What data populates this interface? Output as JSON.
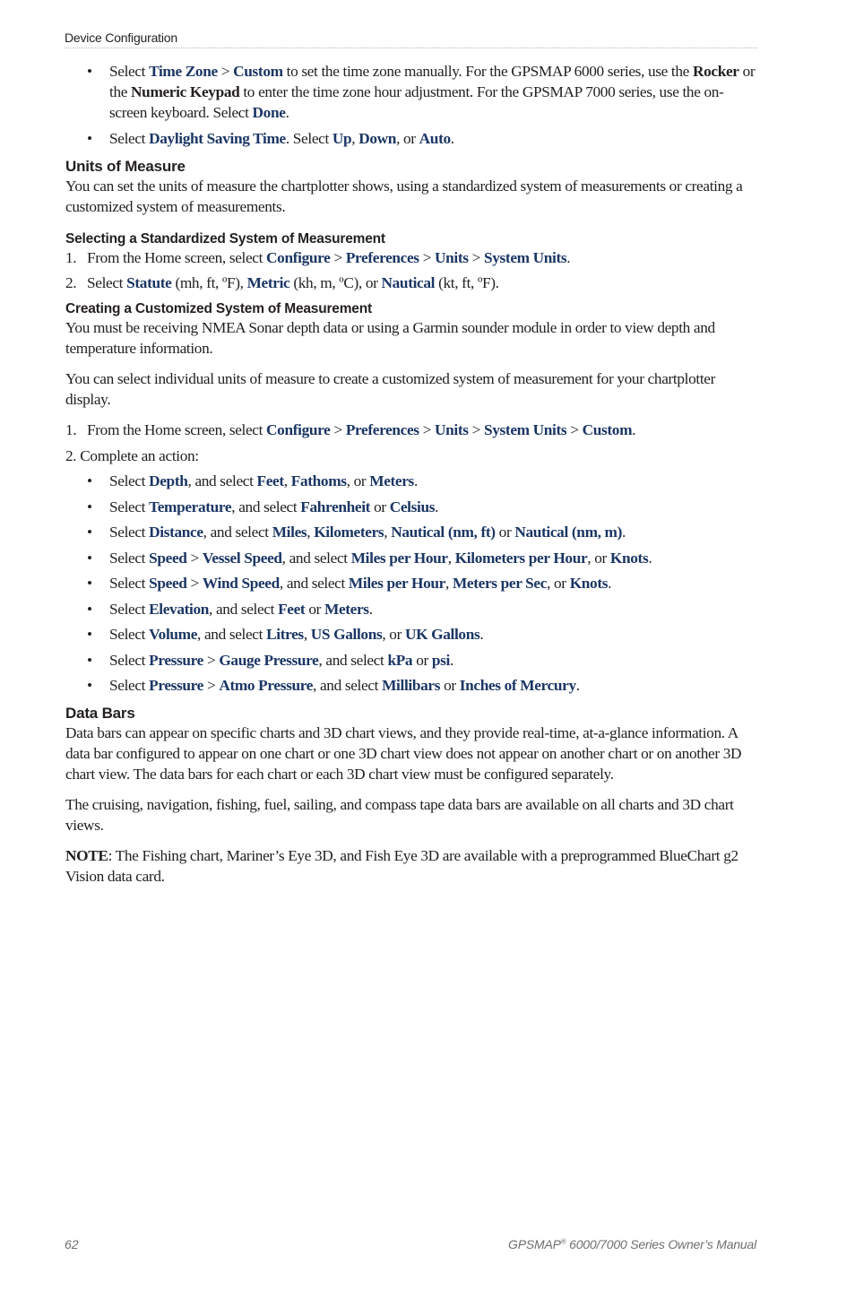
{
  "header": {
    "running_head": "Device Configuration"
  },
  "time_zone_bullets": [
    {
      "parts": [
        {
          "t": "Select "
        },
        {
          "b": "Time Zone"
        },
        {
          "t": " > "
        },
        {
          "b": "Custom"
        },
        {
          "t": " to set the time zone manually. For the GPSMAP 6000 series, use the "
        },
        {
          "k": "Rocker"
        },
        {
          "t": " or the "
        },
        {
          "k": "Numeric Keypad"
        },
        {
          "t": " to enter the time zone hour adjustment. For the GPSMAP 7000 series, use the on-screen keyboard. Select "
        },
        {
          "b": "Done"
        },
        {
          "t": "."
        }
      ]
    },
    {
      "parts": [
        {
          "t": "Select "
        },
        {
          "b": "Daylight Saving Time"
        },
        {
          "t": ". Select "
        },
        {
          "b": "Up"
        },
        {
          "t": ", "
        },
        {
          "b": "Down"
        },
        {
          "t": ", or "
        },
        {
          "b": "Auto"
        },
        {
          "t": "."
        }
      ]
    }
  ],
  "units": {
    "heading": "Units of Measure",
    "intro": "You can set the units of measure the chartplotter shows, using a standardized system of measurements or creating a customized system of measurements.",
    "standard": {
      "heading": "Selecting a Standardized System of Measurement",
      "steps": [
        {
          "num": "1.",
          "parts": [
            {
              "t": "From the Home screen, select "
            },
            {
              "b": "Configure"
            },
            {
              "t": " > "
            },
            {
              "b": "Preferences"
            },
            {
              "t": " > "
            },
            {
              "b": "Units"
            },
            {
              "t": " > "
            },
            {
              "b": "System Units"
            },
            {
              "t": "."
            }
          ]
        },
        {
          "num": "2.",
          "parts": [
            {
              "t": "Select "
            },
            {
              "b": "Statute"
            },
            {
              "t": " (mh, ft, ºF), "
            },
            {
              "b": "Metric"
            },
            {
              "t": " (kh, m, ºC), or "
            },
            {
              "b": "Nautical"
            },
            {
              "t": " (kt, ft, ºF)."
            }
          ]
        }
      ]
    },
    "custom": {
      "heading": "Creating a Customized System of Measurement",
      "para1": "You must be receiving NMEA Sonar depth data or using a Garmin sounder module in order to view depth and temperature information.",
      "para2": "You can select individual units of measure to create a customized system of measurement for your chartplotter display.",
      "step1": {
        "num": "1.",
        "parts": [
          {
            "t": "From the Home screen, select "
          },
          {
            "b": "Configure"
          },
          {
            "t": " > "
          },
          {
            "b": "Preferences"
          },
          {
            "t": " > "
          },
          {
            "b": "Units"
          },
          {
            "t": " > "
          },
          {
            "b": "System Units"
          },
          {
            "t": " > "
          },
          {
            "b": "Custom"
          },
          {
            "t": "."
          }
        ]
      },
      "step2": "2. Complete an action:",
      "bullets": [
        {
          "parts": [
            {
              "t": "Select "
            },
            {
              "b": "Depth"
            },
            {
              "t": ", and select "
            },
            {
              "b": "Feet"
            },
            {
              "t": ", "
            },
            {
              "b": "Fathoms"
            },
            {
              "t": ", or "
            },
            {
              "b": "Meters"
            },
            {
              "t": "."
            }
          ]
        },
        {
          "parts": [
            {
              "t": "Select "
            },
            {
              "b": "Temperature"
            },
            {
              "t": ", and select "
            },
            {
              "b": "Fahrenheit"
            },
            {
              "t": " or "
            },
            {
              "b": "Celsius"
            },
            {
              "t": "."
            }
          ]
        },
        {
          "parts": [
            {
              "t": "Select "
            },
            {
              "b": "Distance"
            },
            {
              "t": ", and select "
            },
            {
              "b": "Miles"
            },
            {
              "t": ", "
            },
            {
              "b": "Kilometers"
            },
            {
              "t": ", "
            },
            {
              "b": "Nautical (nm, ft)"
            },
            {
              "t": " or "
            },
            {
              "b": "Nautical (nm, m)"
            },
            {
              "t": "."
            }
          ]
        },
        {
          "parts": [
            {
              "t": "Select "
            },
            {
              "b": "Speed"
            },
            {
              "t": " > "
            },
            {
              "b": "Vessel Speed"
            },
            {
              "t": ", and select "
            },
            {
              "b": "Miles per Hour"
            },
            {
              "t": ", "
            },
            {
              "b": "Kilometers per Hour"
            },
            {
              "t": ", or "
            },
            {
              "b": "Knots"
            },
            {
              "t": "."
            }
          ]
        },
        {
          "parts": [
            {
              "t": "Select "
            },
            {
              "b": "Speed"
            },
            {
              "t": " > "
            },
            {
              "b": "Wind Speed"
            },
            {
              "t": ", and select "
            },
            {
              "b": "Miles per Hour"
            },
            {
              "t": ", "
            },
            {
              "b": "Meters per Sec"
            },
            {
              "t": ", or "
            },
            {
              "b": "Knots"
            },
            {
              "t": "."
            }
          ]
        },
        {
          "parts": [
            {
              "t": "Select "
            },
            {
              "b": "Elevation"
            },
            {
              "t": ", and select "
            },
            {
              "b": "Feet"
            },
            {
              "t": " or "
            },
            {
              "b": "Meters"
            },
            {
              "t": "."
            }
          ]
        },
        {
          "parts": [
            {
              "t": "Select "
            },
            {
              "b": "Volume"
            },
            {
              "t": ", and select "
            },
            {
              "b": "Litres"
            },
            {
              "t": ", "
            },
            {
              "b": "US Gallons"
            },
            {
              "t": ", or "
            },
            {
              "b": "UK Gallons"
            },
            {
              "t": "."
            }
          ]
        },
        {
          "parts": [
            {
              "t": "Select "
            },
            {
              "b": "Pressure"
            },
            {
              "t": " > "
            },
            {
              "b": "Gauge Pressure"
            },
            {
              "t": ", and select "
            },
            {
              "b": "kPa"
            },
            {
              "t": " or "
            },
            {
              "b": "psi"
            },
            {
              "t": "."
            }
          ]
        },
        {
          "parts": [
            {
              "t": "Select "
            },
            {
              "b": "Pressure"
            },
            {
              "t": " > "
            },
            {
              "b": "Atmo Pressure"
            },
            {
              "t": ", and select "
            },
            {
              "b": "Millibars"
            },
            {
              "t": " or "
            },
            {
              "b": "Inches of Mercury"
            },
            {
              "t": "."
            }
          ]
        }
      ]
    }
  },
  "data_bars": {
    "heading": "Data Bars",
    "para1": "Data bars can appear on specific charts and 3D chart views, and they provide real-time, at-a-glance information. A data bar configured to appear on one chart or one 3D chart view does not appear on another chart or on another 3D chart view. The data bars for each chart or each 3D chart view must be configured separately.",
    "para2": "The cruising, navigation, fishing, fuel, sailing, and compass tape data bars are available on all charts and 3D chart views.",
    "note_label": "NOTE",
    "note_text": ": The Fishing chart, Mariner’s Eye 3D, and Fish Eye 3D are available with a preprogrammed BlueChart g2 Vision data card."
  },
  "footer": {
    "page_number": "62",
    "manual_title_prefix": "GPSMAP",
    "manual_title_reg": "®",
    "manual_title_suffix": " 6000/7000 Series Owner’s Manual"
  }
}
